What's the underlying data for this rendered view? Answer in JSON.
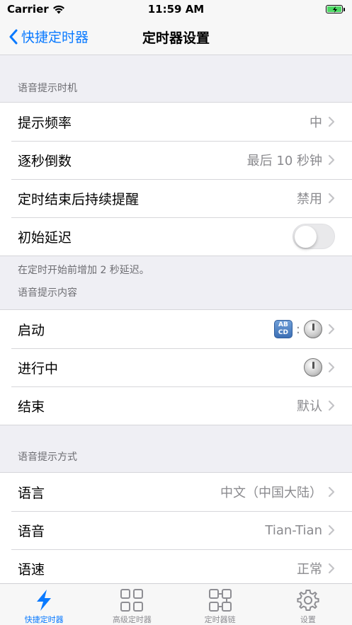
{
  "status_bar": {
    "carrier": "Carrier",
    "time": "11:59 AM"
  },
  "nav": {
    "back_label": "快捷定时器",
    "title": "定时器设置"
  },
  "sections": [
    {
      "header": "语音提示时机",
      "rows": [
        {
          "label": "提示频率",
          "value": "中"
        },
        {
          "label": "逐秒倒数",
          "value": "最后 10 秒钟"
        },
        {
          "label": "定时结束后持续提醒",
          "value": "禁用"
        },
        {
          "label": "初始延迟",
          "toggle_on": false
        }
      ],
      "footer": "在定时开始前增加 2 秒延迟。"
    },
    {
      "header": "语音提示内容",
      "rows": [
        {
          "label": "启动",
          "icon_text_top": "AB",
          "icon_text_bottom": "CD",
          "separator": ":"
        },
        {
          "label": "进行中"
        },
        {
          "label": "结束",
          "value": "默认"
        }
      ]
    },
    {
      "header": "语音提示方式",
      "rows": [
        {
          "label": "语言",
          "value": "中文（中国大陆）"
        },
        {
          "label": "语音",
          "value": "Tian-Tian"
        },
        {
          "label": "语速",
          "value": "正常"
        }
      ]
    }
  ],
  "tabs": [
    {
      "label": "快捷定时器",
      "icon": "lightning-icon",
      "active": true
    },
    {
      "label": "高级定时器",
      "icon": "grid-icon",
      "active": false
    },
    {
      "label": "定时器链",
      "icon": "chain-grid-icon",
      "active": false
    },
    {
      "label": "设置",
      "icon": "gear-icon",
      "active": false
    }
  ],
  "colors": {
    "accent": "#0a7aff",
    "background": "#efeff4",
    "secondary_text": "#8a8a8e"
  }
}
